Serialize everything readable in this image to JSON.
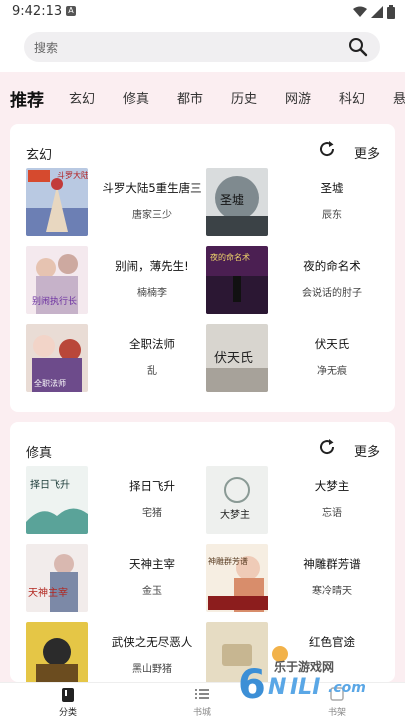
{
  "status_bar": {
    "time": "9:42:13",
    "notif_letter": "A"
  },
  "search": {
    "placeholder": "搜索",
    "icon": "search-icon"
  },
  "tabs": [
    "推荐",
    "玄幻",
    "修真",
    "都市",
    "历史",
    "网游",
    "科幻",
    "悬"
  ],
  "sections": [
    {
      "title": "玄幻",
      "more_label": "更多",
      "books": [
        {
          "title": "斗罗大陆5重生唐三",
          "author": "唐家三少"
        },
        {
          "title": "圣墟",
          "author": "辰东"
        },
        {
          "title": "别闹，薄先生!",
          "author": "楠楠李"
        },
        {
          "title": "夜的命名术",
          "author": "会说话的肘子"
        },
        {
          "title": "全职法师",
          "author": "乱"
        },
        {
          "title": "伏天氏",
          "author": "净无痕"
        }
      ]
    },
    {
      "title": "修真",
      "more_label": "更多",
      "books": [
        {
          "title": "择日飞升",
          "author": "宅猪"
        },
        {
          "title": "大梦主",
          "author": "忘语"
        },
        {
          "title": "天神主宰",
          "author": "金玉"
        },
        {
          "title": "神雕群芳谱",
          "author": "寒冷晴天"
        },
        {
          "title": "武侠之无尽恶人",
          "author": "黑山野猪"
        },
        {
          "title": "红色官途",
          "author": ""
        }
      ]
    }
  ],
  "covers": {
    "c0": "斗罗大陆",
    "c1": "圣墟",
    "c2": "别闹执行长",
    "c3": "夜的命名术",
    "c4": "全职法师",
    "c5": "伏天氏",
    "c6": "择日飞升",
    "c7": "大梦主",
    "c8": "天神主宰",
    "c9": "神雕群芳谱"
  },
  "bottom_nav": [
    {
      "label": "分类",
      "icon": "book-icon",
      "active": true
    },
    {
      "label": "书城",
      "icon": "list-icon",
      "active": false
    },
    {
      "label": "书架",
      "icon": "shelf-icon",
      "active": false
    }
  ],
  "watermark": {
    "text": "乐于游戏网"
  },
  "colors": {
    "background": "#fbeef1",
    "card": "#ffffff",
    "search_bg": "#f0eff1"
  }
}
